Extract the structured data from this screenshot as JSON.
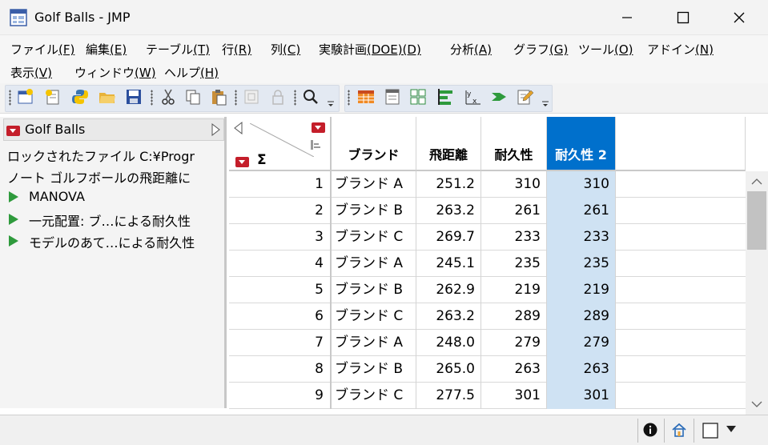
{
  "window": {
    "title": "Golf Balls - JMP",
    "minimize_glyph": "—",
    "maximize_glyph": "☐",
    "close_glyph": "✕"
  },
  "menu": {
    "row1": [
      {
        "label": "ファイル",
        "key": "(F)"
      },
      {
        "label": "編集",
        "key": "(E)"
      },
      {
        "label": "テーブル",
        "key": "(T)"
      },
      {
        "label": "行",
        "key": "(R)"
      },
      {
        "label": "列",
        "key": "(C)"
      },
      {
        "label": "実験計画",
        "key": "(DOE)(D)"
      },
      {
        "label": "分析",
        "key": "(A)"
      },
      {
        "label": "グラフ",
        "key": "(G)"
      },
      {
        "label": "ツール",
        "key": "(O)"
      },
      {
        "label": "アドイン",
        "key": "(N)"
      }
    ],
    "row2": [
      {
        "label": "表示",
        "key": "(V)"
      },
      {
        "label": "ウィンドウ",
        "key": "(W)"
      },
      {
        "label": "ヘルプ",
        "key": "(H)"
      }
    ]
  },
  "toolbar": {
    "icons": [
      "new-data-table-icon",
      "new-script-icon",
      "python-icon",
      "open-folder-icon",
      "save-icon",
      "cut-icon",
      "copy-icon",
      "paste-icon",
      "copy-disabled-icon",
      "lock-disabled-icon",
      "search-icon",
      "data-table-icon",
      "table-list-icon",
      "grid-icon",
      "bar-align-icon",
      "formula-icon",
      "arrow-icon",
      "edit-icon"
    ]
  },
  "left_panel": {
    "title": "Golf Balls",
    "locked_file": "ロックされたファイル  C:¥Progr",
    "note": "ノート ゴルフボールの飛距離に",
    "scripts": [
      "MANOVA",
      "一元配置: ブ…による耐久性",
      "モデルのあて…による耐久性"
    ]
  },
  "table": {
    "sigma": "Σ",
    "columns": [
      "ブランド",
      "飛距離",
      "耐久性",
      "耐久性 2"
    ],
    "rows": [
      {
        "n": "1",
        "brand": "ブランド A",
        "dist": "251.2",
        "dur": "310",
        "dur2": "310"
      },
      {
        "n": "2",
        "brand": "ブランド B",
        "dist": "263.2",
        "dur": "261",
        "dur2": "261"
      },
      {
        "n": "3",
        "brand": "ブランド C",
        "dist": "269.7",
        "dur": "233",
        "dur2": "233"
      },
      {
        "n": "4",
        "brand": "ブランド A",
        "dist": "245.1",
        "dur": "235",
        "dur2": "235"
      },
      {
        "n": "5",
        "brand": "ブランド B",
        "dist": "262.9",
        "dur": "219",
        "dur2": "219"
      },
      {
        "n": "6",
        "brand": "ブランド C",
        "dist": "263.2",
        "dur": "289",
        "dur2": "289"
      },
      {
        "n": "7",
        "brand": "ブランド A",
        "dist": "248.0",
        "dur": "279",
        "dur2": "279"
      },
      {
        "n": "8",
        "brand": "ブランド B",
        "dist": "265.0",
        "dur": "263",
        "dur2": "263"
      },
      {
        "n": "9",
        "brand": "ブランド C",
        "dist": "277.5",
        "dur": "301",
        "dur2": "301"
      }
    ],
    "selected_column_color": "#0070cc"
  },
  "colors": {
    "red_hotspot": "#c41e2a",
    "script_green": "#2e9a3c",
    "selection": "#cfe2f3"
  }
}
